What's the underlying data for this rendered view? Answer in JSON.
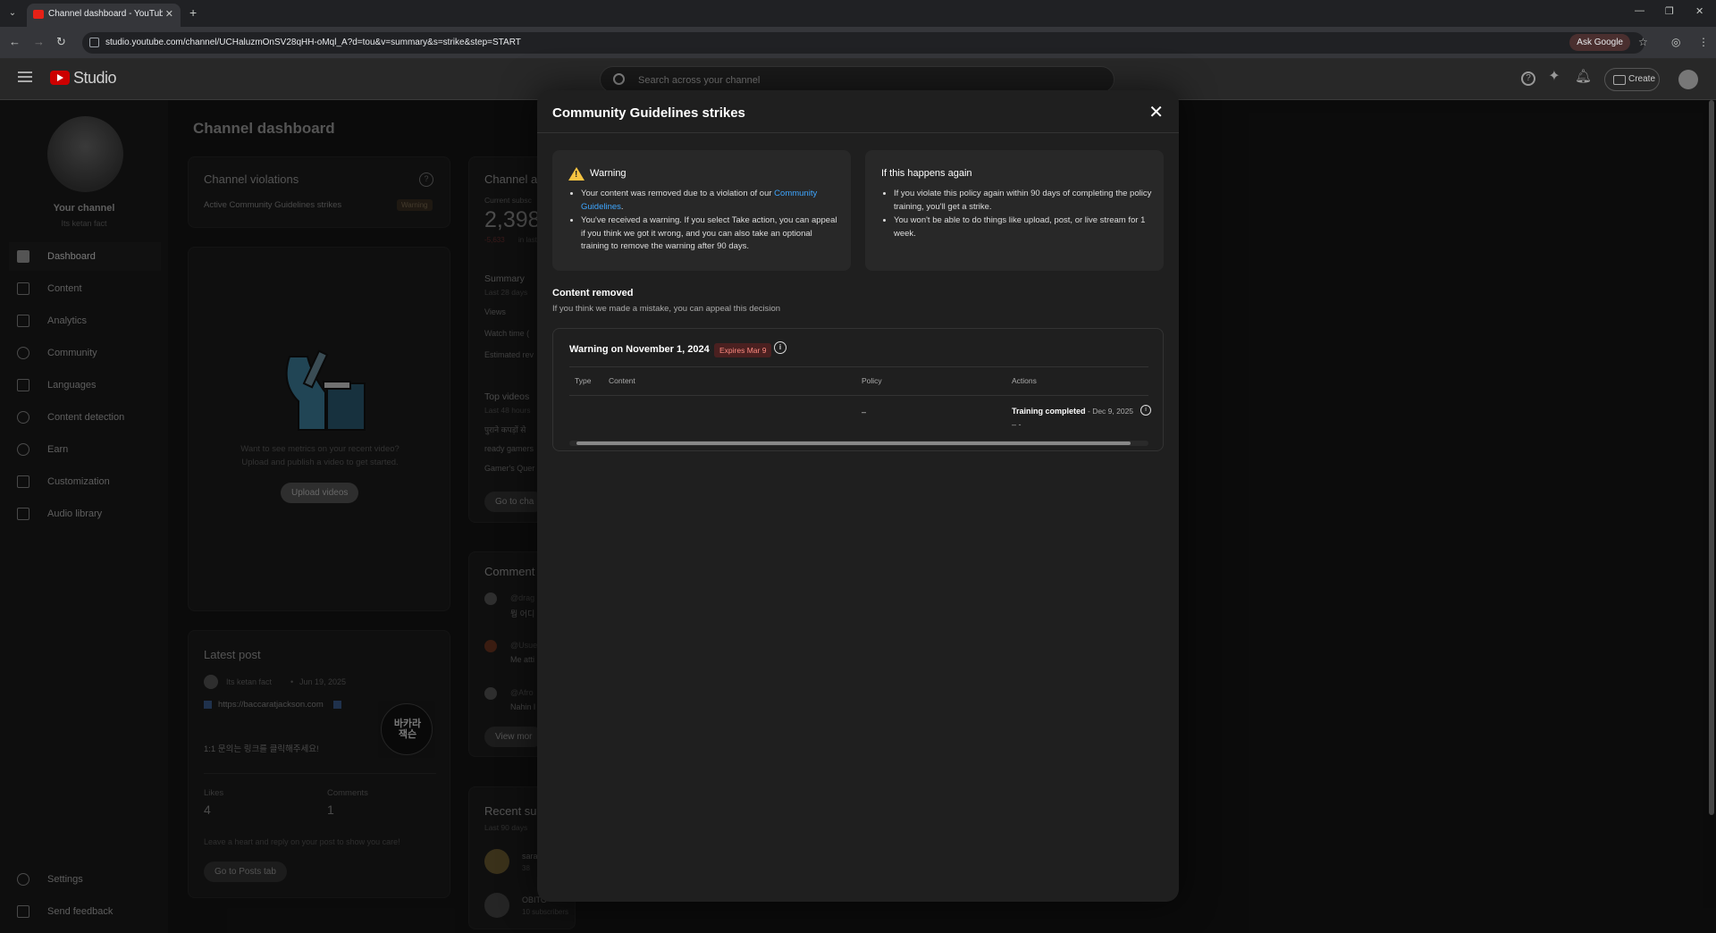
{
  "browser": {
    "tab_title": "Channel dashboard - YouTube Studio",
    "new_tab": "+",
    "url": "studio.youtube.com/channel/UCHaluzmOnSV28qHH-oMql_A?d=tou&v=summary&s=strike&step=START",
    "ask_google": "Ask Google"
  },
  "header": {
    "logo": "Studio",
    "search_placeholder": "Search across your channel",
    "create_label": "Create"
  },
  "sidebar": {
    "channel_name": "Your channel",
    "channel_handle": "Its ketan fact",
    "items": [
      {
        "label": "Dashboard",
        "icon": "dashboard-icon"
      },
      {
        "label": "Content",
        "icon": "content-icon"
      },
      {
        "label": "Analytics",
        "icon": "analytics-icon"
      },
      {
        "label": "Community",
        "icon": "community-icon"
      },
      {
        "label": "Languages",
        "icon": "languages-icon"
      },
      {
        "label": "Content detection",
        "icon": "content-detection-icon"
      },
      {
        "label": "Earn",
        "icon": "earn-icon"
      },
      {
        "label": "Customization",
        "icon": "customization-icon"
      },
      {
        "label": "Audio library",
        "icon": "audio-library-icon"
      }
    ],
    "settings": "Settings",
    "send_feedback": "Send feedback"
  },
  "dashboard": {
    "title": "Channel dashboard",
    "violations": {
      "title": "Channel violations",
      "row_label": "Active Community Guidelines strikes",
      "chip": "Warning"
    },
    "upload_card": {
      "text_line1": "Want to see metrics on your recent video?",
      "text_line2": "Upload and publish a video to get started.",
      "button": "Upload videos"
    },
    "latest_post": {
      "title": "Latest post",
      "author": "Its ketan fact",
      "date": "Jun 19, 2025",
      "link": "https://baccaratjackson.com",
      "body": "1:1 문의는 링크를 클릭해주세요!",
      "thumb_text": "바카라 잭슨",
      "likes_label": "Likes",
      "likes_value": "4",
      "comments_label": "Comments",
      "comments_value": "1",
      "hint": "Leave a heart and reply on your post to show you care!",
      "button": "Go to Posts tab"
    },
    "analytics_col": {
      "title": "Channel a",
      "current_label": "Current subsc",
      "current_value": "2,398",
      "delta": "-5,633",
      "delta_suffix": "in last 2",
      "summary": "Summary",
      "summary_sub": "Last 28 days",
      "rows": [
        "Views",
        "Watch time (",
        "Estimated rev"
      ],
      "top_videos": "Top videos",
      "top_videos_sub": "Last 48 hours",
      "top_list": [
        "पुराने कपड़ों से",
        "ready gamers",
        "Gamer's Quer"
      ],
      "go_button": "Go to cha",
      "comments": "Comment",
      "comment_users": [
        {
          "user": "@drag",
          "text": "뭥 어디"
        },
        {
          "user": "@Usue",
          "text": "Me atti"
        },
        {
          "user": "@Afro",
          "text": "Nahin l"
        }
      ],
      "view_more": "View mor",
      "recent_subs": "Recent su",
      "recent_sub_sub": "Last 90 days",
      "subs": [
        {
          "name": "sara",
          "count": "38"
        },
        {
          "name": "OBITO",
          "count": "10 subscribers"
        }
      ]
    }
  },
  "modal": {
    "title": "Community Guidelines strikes",
    "warning_box": {
      "title": "Warning",
      "bullet1_pre": "Your content was removed due to a violation of our ",
      "bullet1_link": "Community Guidelines",
      "bullet1_post": ".",
      "bullet2": "You've received a warning. If you select Take action, you can appeal if you think we got it wrong, and you can also take an optional training to remove the warning after 90 days."
    },
    "again_box": {
      "title": "If this happens again",
      "bullet1": "If you violate this policy again within 90 days of completing the policy training, you'll get a strike.",
      "bullet2": "You won't be able to do things like upload, post, or live stream for 1 week."
    },
    "content_removed": {
      "title": "Content removed",
      "subtitle": "If you think we made a mistake, you can appeal this decision"
    },
    "strike": {
      "title": "Warning on November 1, 2024",
      "expires": "Expires Mar 9",
      "columns": [
        "Type",
        "Content",
        "Policy",
        "Actions"
      ],
      "row": {
        "type": "",
        "content": "",
        "policy": "–",
        "action_status": "Training completed",
        "action_date": " - Dec 9, 2025",
        "action_sub": "– -"
      }
    }
  }
}
